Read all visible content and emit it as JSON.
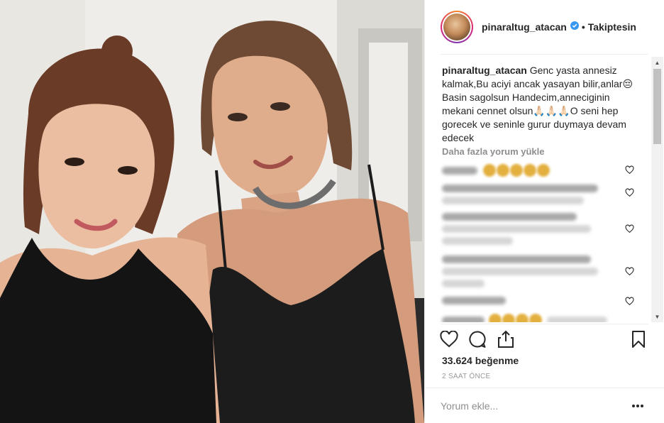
{
  "post": {
    "username": "pinaraltug_atacan",
    "separator": "•",
    "follow_state": "Takiptesin",
    "caption_user": "pinaraltug_atacan",
    "caption_text": "Genc yasta annesiz kalmak,Bu aciyi ancak yasayan bilir,anlar😔 Basin sagolsun Handecim,anneciginin mekani cennet olsun🙏🏻🙏🏻🙏🏻O seni hep gorecek ve seninle gurur duymaya devam edecek",
    "load_more": "Daha fazla yorum yükle",
    "likes": "33.624 beğenme",
    "time": "2 SAAT ÖNCE",
    "comment_placeholder": "Yorum ekle...",
    "more_icon": "…"
  },
  "icons": {
    "verified": "verified-badge-icon",
    "like": "heart-icon",
    "comment": "comment-bubble-icon",
    "share": "share-icon",
    "save": "bookmark-icon",
    "more": "ellipsis-icon"
  },
  "colors": {
    "verified_blue": "#3897f0",
    "ring_start": "#f58529",
    "ring_mid": "#dd2a7b",
    "muted_text": "#8e8e8e"
  }
}
